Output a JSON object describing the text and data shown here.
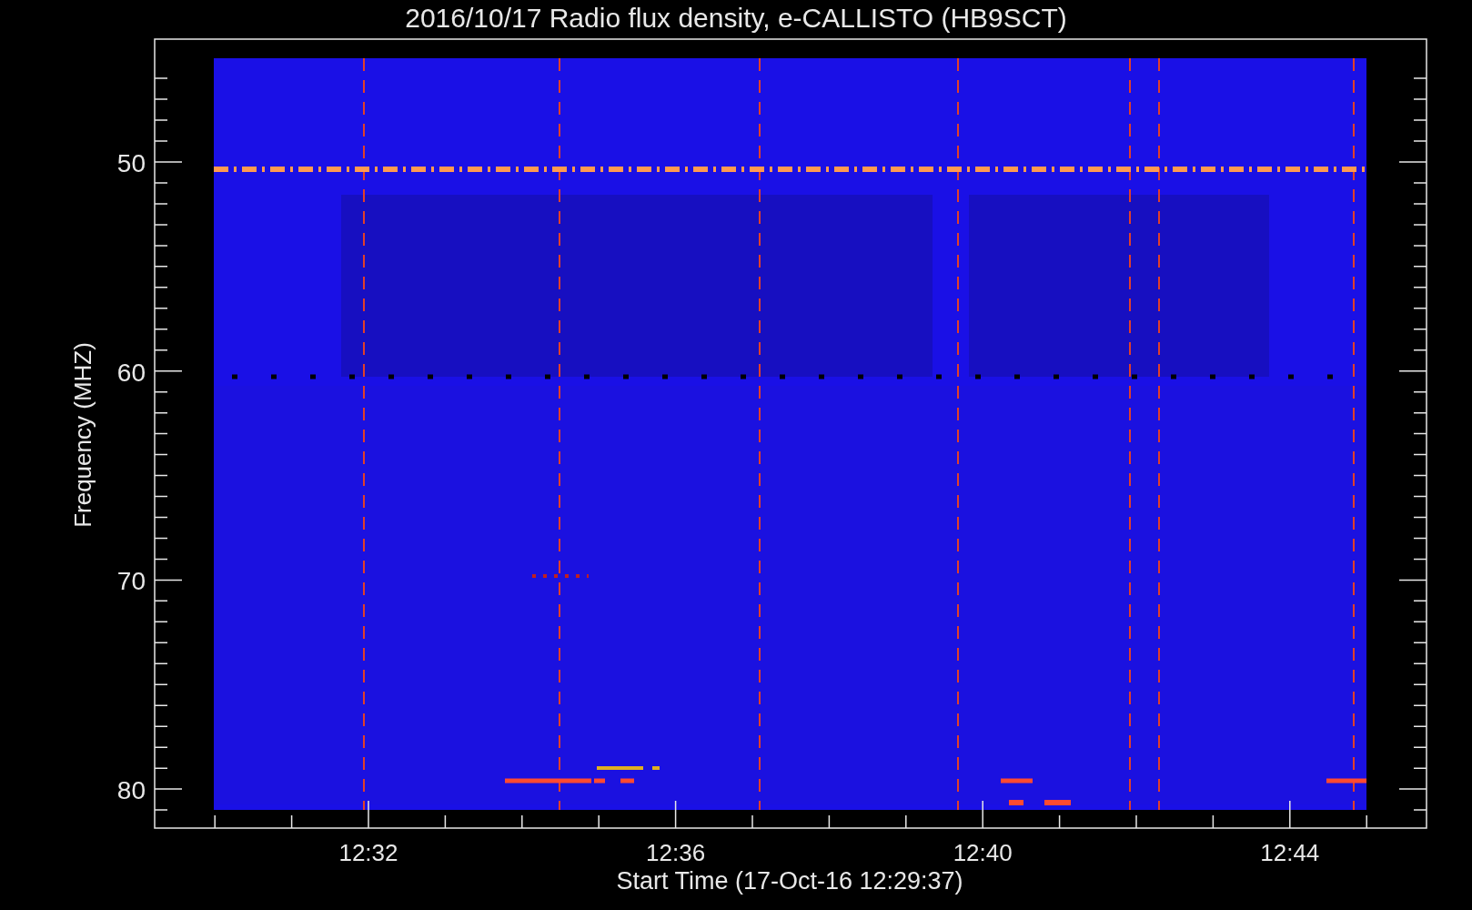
{
  "title": "2016/10/17  Radio flux density, e-CALLISTO (HB9SCT)",
  "y_axis": {
    "label": "Frequency (MHZ)",
    "ticks": [
      "50",
      "60",
      "70",
      "80"
    ]
  },
  "x_axis": {
    "label": "Start Time (17-Oct-16 12:29:37)",
    "ticks": [
      "12:32",
      "12:36",
      "12:40",
      "12:44"
    ]
  }
}
